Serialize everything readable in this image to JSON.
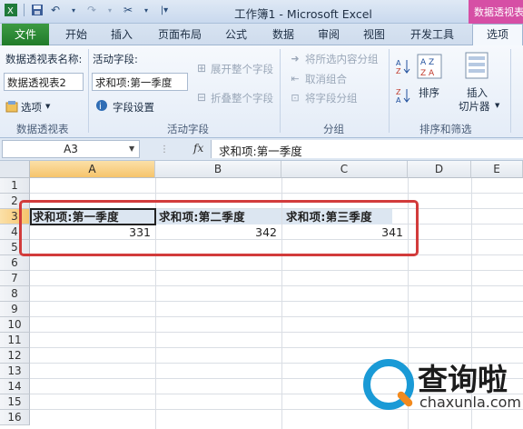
{
  "window": {
    "title": "工作簿1 - Microsoft Excel",
    "context_tab": "数据透视表"
  },
  "tabs": {
    "file": "文件",
    "items": [
      "开始",
      "插入",
      "页面布局",
      "公式",
      "数据",
      "审阅",
      "视图",
      "开发工具"
    ],
    "active": "选项"
  },
  "ribbon": {
    "pivot_group": {
      "name_label": "数据透视表名称:",
      "name_value": "数据透视表2",
      "options_button": "选项",
      "group_label": "数据透视表"
    },
    "active_field_group": {
      "label": "活动字段:",
      "field_value": "求和项:第一季度",
      "field_settings": "字段设置",
      "expand_all": "展开整个字段",
      "collapse_all": "折叠整个字段",
      "group_label": "活动字段"
    },
    "group_group": {
      "group_selection": "将所选内容分组",
      "ungroup": "取消组合",
      "group_field": "将字段分组",
      "group_label": "分组"
    },
    "sort_group": {
      "sort": "排序",
      "insert_slicer_1": "插入",
      "insert_slicer_2": "切片器",
      "group_label": "排序和筛选"
    }
  },
  "formula_bar": {
    "name_box": "A3",
    "fx": "fx",
    "content": "求和项:第一季度"
  },
  "grid": {
    "columns": [
      "A",
      "B",
      "C",
      "D",
      "E"
    ],
    "rows": [
      "1",
      "2",
      "3",
      "4",
      "5",
      "6",
      "7",
      "8",
      "9",
      "10",
      "11",
      "12",
      "13",
      "14",
      "15",
      "16"
    ],
    "pivot_headers": [
      "求和项:第一季度",
      "求和项:第二季度",
      "求和项:第三季度"
    ],
    "pivot_values": [
      "331",
      "342",
      "341"
    ]
  },
  "watermark": {
    "title": "查询啦",
    "url": "chaxunla.com"
  },
  "colors": {
    "file_tab": "#2e7d32",
    "context_tab": "#d64fa5",
    "highlight_box": "#d23b3b",
    "selected_header": "#f6c46b"
  }
}
